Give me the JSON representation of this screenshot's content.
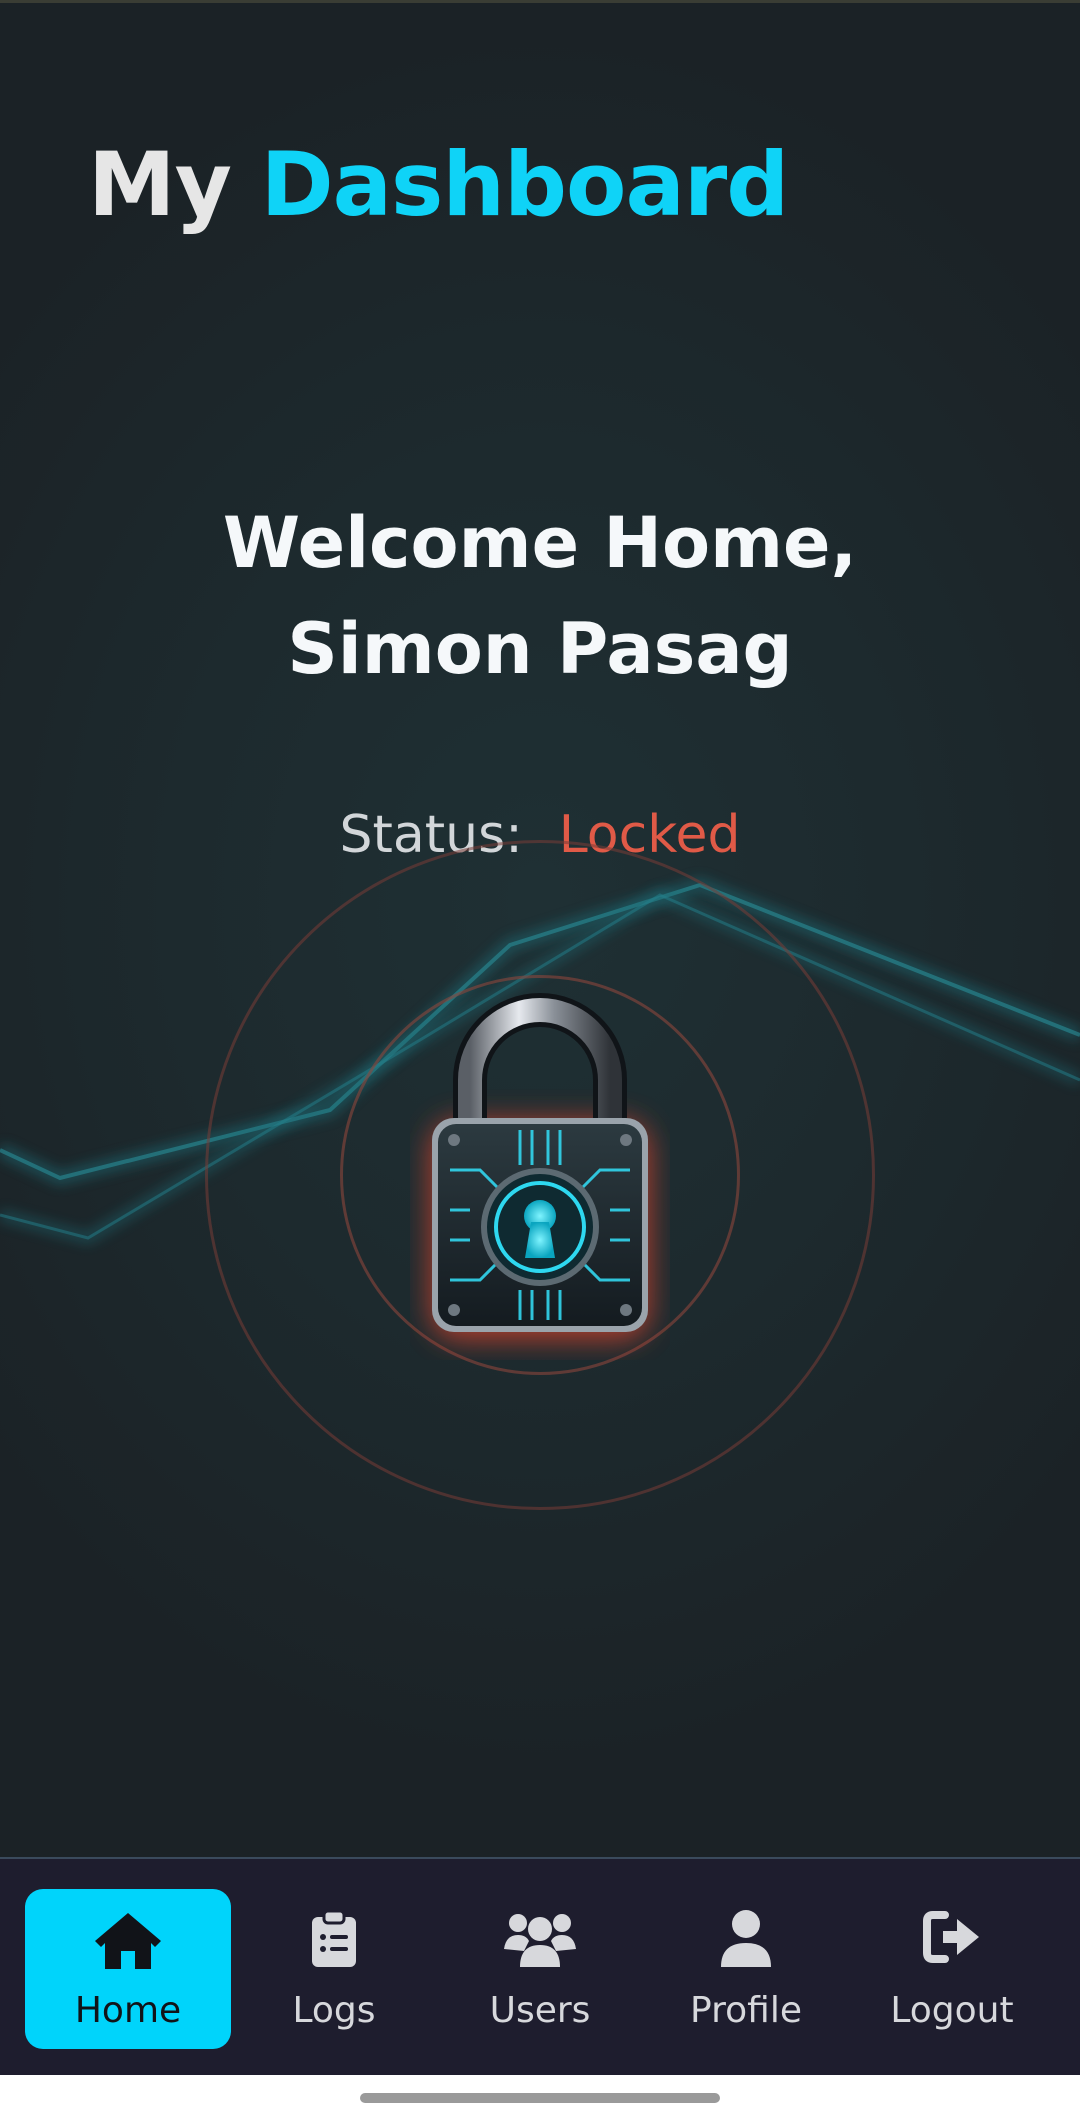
{
  "app": {
    "title_part1": "My",
    "title_part2": "Dashboard"
  },
  "welcome": {
    "text": "Welcome Home, Simon Pasag"
  },
  "status": {
    "label": "Status:",
    "value": "Locked",
    "value_color": "#e05a47"
  },
  "lock": {
    "icon": "padlock-icon",
    "state": "locked"
  },
  "nav": {
    "items": [
      {
        "label": "Home",
        "icon": "home-icon",
        "active": true
      },
      {
        "label": "Logs",
        "icon": "clipboard-list-icon",
        "active": false
      },
      {
        "label": "Users",
        "icon": "users-icon",
        "active": false
      },
      {
        "label": "Profile",
        "icon": "user-icon",
        "active": false
      },
      {
        "label": "Logout",
        "icon": "logout-icon",
        "active": false
      }
    ]
  },
  "colors": {
    "accent": "#00d4fb",
    "background": "#1b2226",
    "nav_background": "#1e1d2e",
    "locked_red": "#e05a47"
  }
}
